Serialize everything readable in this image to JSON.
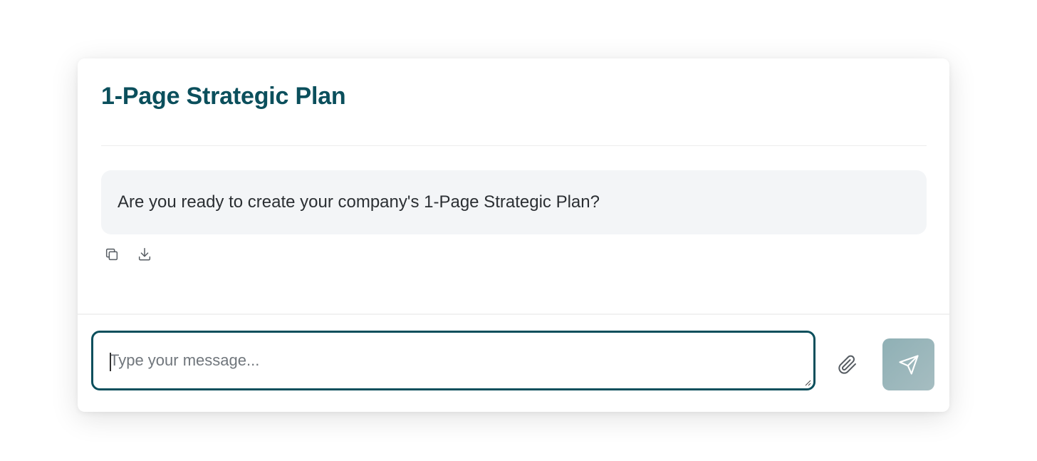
{
  "header": {
    "title": "1-Page Strategic Plan"
  },
  "messages": [
    {
      "text": "Are you ready to create your company's 1-Page Strategic Plan?",
      "actions": [
        {
          "icon": "copy-icon"
        },
        {
          "icon": "download-icon"
        }
      ]
    }
  ],
  "composer": {
    "placeholder": "Type your message...",
    "value": "",
    "attach_icon": "paperclip-icon",
    "send_icon": "send-icon"
  },
  "colors": {
    "accent": "#0b4f5c",
    "bubble_bg": "#f3f5f7",
    "send_button": "#9ab6ba"
  }
}
